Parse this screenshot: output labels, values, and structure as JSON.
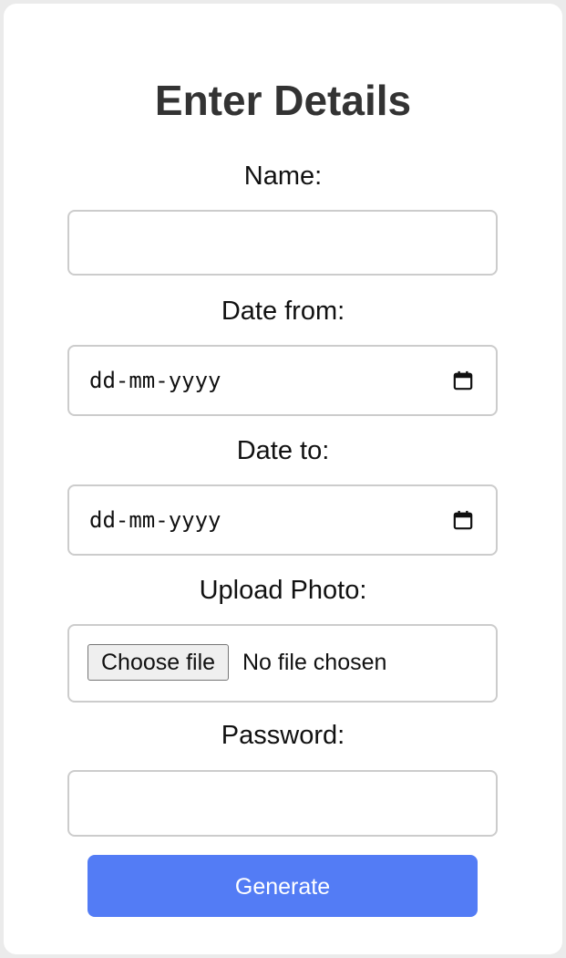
{
  "form": {
    "title": "Enter Details",
    "fields": {
      "name": {
        "label": "Name:",
        "value": ""
      },
      "date_from": {
        "label": "Date from:",
        "placeholder": "dd-mm-yyyy"
      },
      "date_to": {
        "label": "Date to:",
        "placeholder": "dd-mm-yyyy"
      },
      "photo": {
        "label": "Upload Photo:",
        "button_label": "Choose file",
        "status": "No file chosen"
      },
      "password": {
        "label": "Password:",
        "value": ""
      }
    },
    "submit_label": "Generate"
  },
  "colors": {
    "page_background": "#ebebeb",
    "card_background": "#ffffff",
    "title": "#333333",
    "field_border": "#cccccc",
    "submit_button": "#537cf5",
    "submit_text": "#ffffff"
  },
  "icons": {
    "date_picker": "calendar-icon"
  }
}
